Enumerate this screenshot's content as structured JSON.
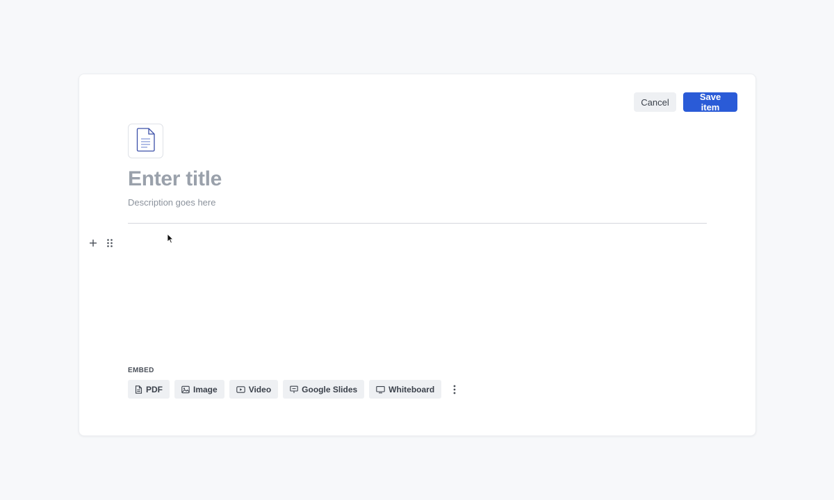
{
  "header": {
    "cancel_label": "Cancel",
    "save_label": "Save item"
  },
  "document": {
    "icon": "document-icon",
    "title_placeholder": "Enter title",
    "description_placeholder": "Description goes here"
  },
  "block_tools": {
    "add_icon": "plus-icon",
    "drag_icon": "drag-handle-icon"
  },
  "embed": {
    "label": "EMBED",
    "options": [
      {
        "label": "PDF",
        "icon": "pdf-icon"
      },
      {
        "label": "Image",
        "icon": "image-icon"
      },
      {
        "label": "Video",
        "icon": "video-icon"
      },
      {
        "label": "Google Slides",
        "icon": "slides-icon"
      },
      {
        "label": "Whiteboard",
        "icon": "whiteboard-icon"
      }
    ],
    "more_icon": "more-vertical-icon"
  },
  "colors": {
    "accent": "#2a5bd7",
    "background": "#f7f8fa"
  }
}
